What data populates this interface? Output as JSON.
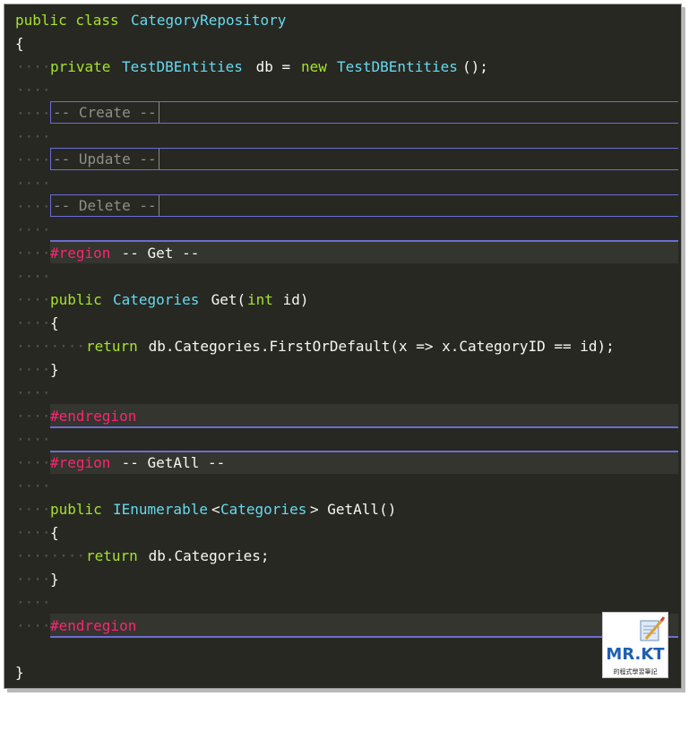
{
  "code": {
    "class_line": {
      "kw": "public class",
      "name": "CategoryRepository"
    },
    "brace_open": "{",
    "field_line": {
      "kw": "private",
      "type": "TestDBEntities",
      "mid": " db = ",
      "new_kw": "new",
      "ctor": "TestDBEntities",
      "end": "();"
    },
    "collapsed_regions": [
      "-- Create --",
      "-- Update --",
      "-- Delete --"
    ],
    "region_get": {
      "directive": "#region",
      "name": " -- Get --"
    },
    "get_sig": {
      "kw": "public",
      "type": "Categories",
      "name": " Get(",
      "param_kw": "int",
      "rest": " id)"
    },
    "get_brace_open": "{",
    "get_return": {
      "kw": "return",
      "expr": " db.Categories.FirstOrDefault(x => x.CategoryID == id);"
    },
    "get_brace_close": "}",
    "endregion_1": "#endregion",
    "region_getall": {
      "directive": "#region",
      "name": " -- GetAll --"
    },
    "getall_sig": {
      "kw": "public",
      "type": "IEnumerable",
      "lt": "<",
      "type_arg": "Categories",
      "rest": "> GetAll()"
    },
    "getall_brace_open": "{",
    "getall_return": {
      "kw": "return",
      "expr": " db.Categories;"
    },
    "getall_brace_close": "}",
    "endregion_2": "#endregion",
    "brace_close": "}"
  },
  "colors": {
    "background": "#272822",
    "keyword": "#a6e22e",
    "type": "#66d9ef",
    "preprocessor": "#f92672",
    "comment": "#8f908a",
    "region_line": "#6c6cd6"
  },
  "watermark": {
    "title": "MR.KT",
    "subtitle": "的程式學習筆記"
  }
}
